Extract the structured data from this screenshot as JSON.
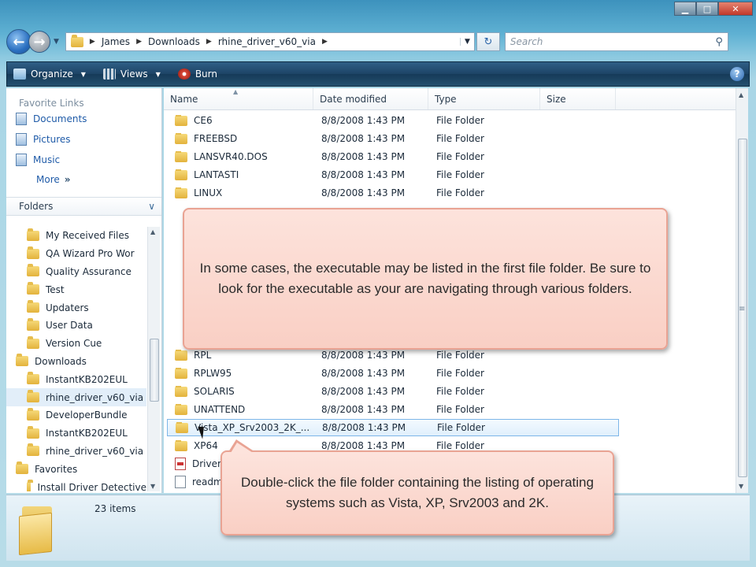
{
  "window": {
    "caption_buttons": {
      "minimize": "▁",
      "maximize": "□",
      "close": "✕"
    }
  },
  "address_bar": {
    "crumbs": [
      "James",
      "Downloads",
      "rhine_driver_v60_via"
    ],
    "refresh_icon": "refresh-icon"
  },
  "search": {
    "placeholder": "Search"
  },
  "toolbar": {
    "organize_label": "Organize",
    "views_label": "Views",
    "burn_label": "Burn",
    "help_label": "?"
  },
  "navpane": {
    "favorite_links_label": "Favorite Links",
    "favorite_links": [
      "Documents",
      "Pictures",
      "Music"
    ],
    "more_label": "More",
    "folders_label": "Folders",
    "tree": [
      {
        "label": "My Received Files",
        "level": 1
      },
      {
        "label": "QA Wizard Pro Wor",
        "level": 1
      },
      {
        "label": "Quality Assurance",
        "level": 1
      },
      {
        "label": "Test",
        "level": 1
      },
      {
        "label": "Updaters",
        "level": 1
      },
      {
        "label": "User Data",
        "level": 1
      },
      {
        "label": "Version Cue",
        "level": 1
      },
      {
        "label": "Downloads",
        "level": 0
      },
      {
        "label": "InstantKB202EUL",
        "level": 1
      },
      {
        "label": "rhine_driver_v60_via",
        "level": 1,
        "selected": true
      },
      {
        "label": "DeveloperBundle",
        "level": 1
      },
      {
        "label": "InstantKB202EUL",
        "level": 1
      },
      {
        "label": "rhine_driver_v60_via",
        "level": 1
      },
      {
        "label": "Favorites",
        "level": 0
      },
      {
        "label": "Install Driver Detective",
        "level": 1
      }
    ]
  },
  "columns": {
    "name": "Name",
    "date": "Date modified",
    "type": "Type",
    "size": "Size"
  },
  "files": [
    {
      "name": "CE6",
      "date": "8/8/2008 1:43 PM",
      "type": "File Folder",
      "icon": "folder"
    },
    {
      "name": "FREEBSD",
      "date": "8/8/2008 1:43 PM",
      "type": "File Folder",
      "icon": "folder"
    },
    {
      "name": "LANSVR40.DOS",
      "date": "8/8/2008 1:43 PM",
      "type": "File Folder",
      "icon": "folder"
    },
    {
      "name": "LANTASTI",
      "date": "8/8/2008 1:43 PM",
      "type": "File Folder",
      "icon": "folder"
    },
    {
      "name": "LINUX",
      "date": "8/8/2008 1:43 PM",
      "type": "File Folder",
      "icon": "folder"
    },
    {
      "name": "RPL",
      "date": "8/8/2008 1:43 PM",
      "type": "File Folder",
      "icon": "folder"
    },
    {
      "name": "RPLW95",
      "date": "8/8/2008 1:43 PM",
      "type": "File Folder",
      "icon": "folder"
    },
    {
      "name": "SOLARIS",
      "date": "8/8/2008 1:43 PM",
      "type": "File Folder",
      "icon": "folder"
    },
    {
      "name": "UNATTEND",
      "date": "8/8/2008 1:43 PM",
      "type": "File Folder",
      "icon": "folder"
    },
    {
      "name": "Vista_XP_Srv2003_2K_...",
      "date": "8/8/2008 1:43 PM",
      "type": "File Folder",
      "icon": "folder",
      "hover": true
    },
    {
      "name": "XP64",
      "date": "8/8/2008 1:43 PM",
      "type": "File Folder",
      "icon": "folder"
    },
    {
      "name": "Driver",
      "date": "",
      "type": "",
      "icon": "pdf"
    },
    {
      "name": "readme",
      "date": "",
      "type": "",
      "icon": "txt"
    }
  ],
  "status": {
    "item_count": "23 items"
  },
  "callouts": {
    "first": "In some cases, the executable may be listed in the first file folder. Be sure to look for the executable as your are navigating through various folders.",
    "second": "Double-click the file folder containing the listing of operating systems such as Vista, XP, Srv2003 and 2K."
  }
}
